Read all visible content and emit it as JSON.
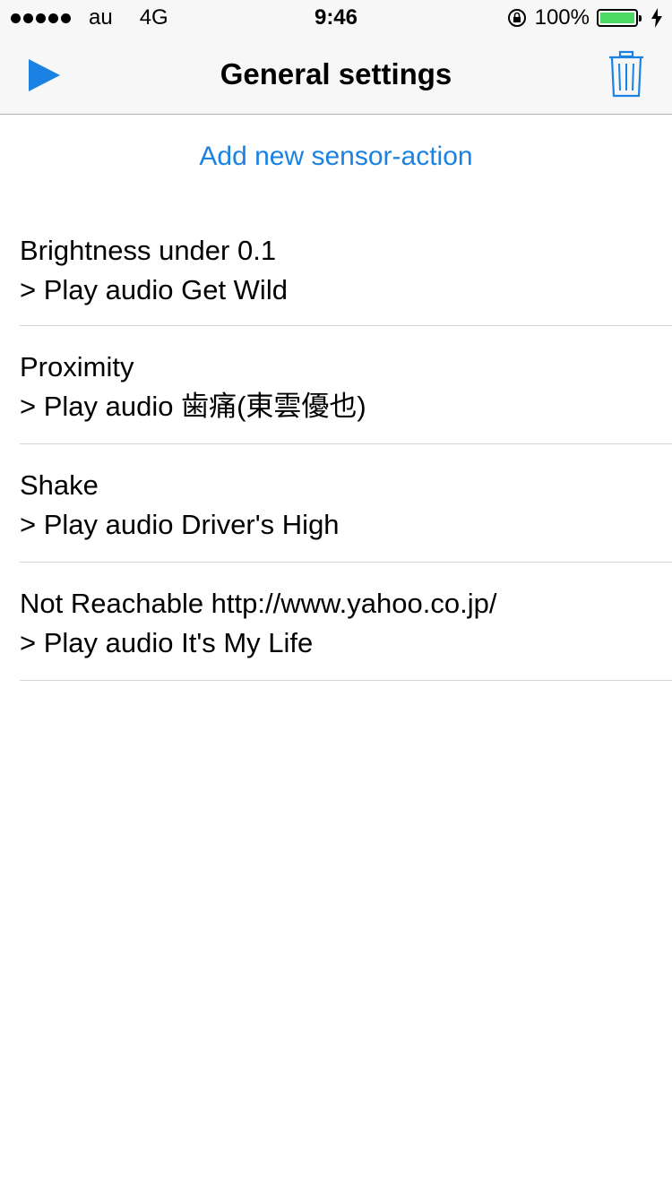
{
  "status_bar": {
    "carrier": "au",
    "network": "4G",
    "time": "9:46",
    "battery_text": "100%",
    "battery_level": 1.0,
    "battery_color": "#4cd964"
  },
  "nav": {
    "title": "General settings",
    "play_icon": "play-icon",
    "trash_icon": "trash-icon",
    "accent_color": "#1a82e2"
  },
  "add_action_label": "Add new sensor-action",
  "rules": [
    {
      "sensor": "Brightness under 0.1",
      "action": "> Play audio Get Wild"
    },
    {
      "sensor": "Proximity",
      "action": "> Play audio 歯痛(東雲優也)"
    },
    {
      "sensor": "Shake",
      "action": "> Play audio Driver's High"
    },
    {
      "sensor": "Not Reachable http://www.yahoo.co.jp/",
      "action": "> Play audio It's My Life"
    }
  ]
}
